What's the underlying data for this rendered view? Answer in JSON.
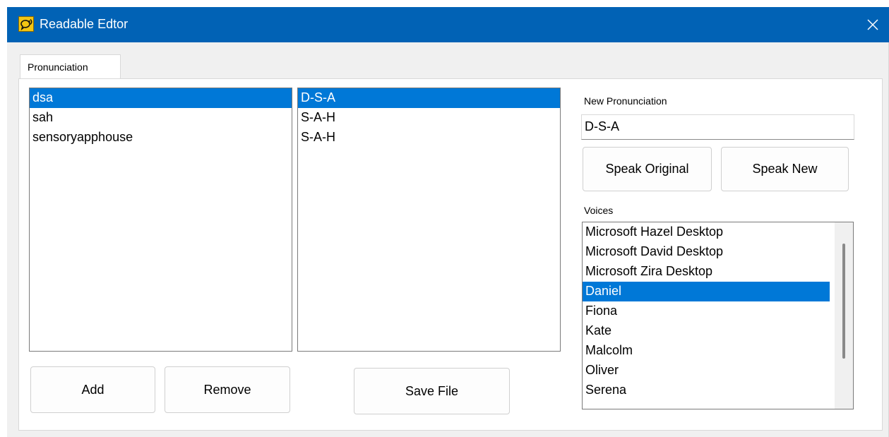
{
  "window": {
    "title": "Readable Edtor"
  },
  "tabs": [
    {
      "label": "Pronunciation"
    }
  ],
  "words": {
    "items": [
      "dsa",
      "sah",
      "sensoryapphouse"
    ],
    "selected_index": 0
  },
  "pronunciations": {
    "items": [
      "D-S-A",
      "S-A-H",
      "S-A-H"
    ],
    "selected_index": 0
  },
  "new_pronunciation": {
    "label": "New Pronunciation",
    "value": "D-S-A"
  },
  "buttons": {
    "add": "Add",
    "remove": "Remove",
    "save_file": "Save File",
    "speak_original": "Speak Original",
    "speak_new": "Speak New"
  },
  "voices": {
    "label": "Voices",
    "items": [
      "Microsoft Hazel Desktop",
      "Microsoft David Desktop",
      "Microsoft Zira Desktop",
      "Daniel",
      "Fiona",
      "Kate",
      "Malcolm",
      "Oliver",
      "Serena"
    ],
    "selected_index": 3
  },
  "colors": {
    "titlebar": "#0162b5",
    "selection": "#0078d7",
    "app_icon": "#f3c513"
  },
  "icons": {
    "app": "speech-bubble-icon",
    "close": "close-icon"
  }
}
